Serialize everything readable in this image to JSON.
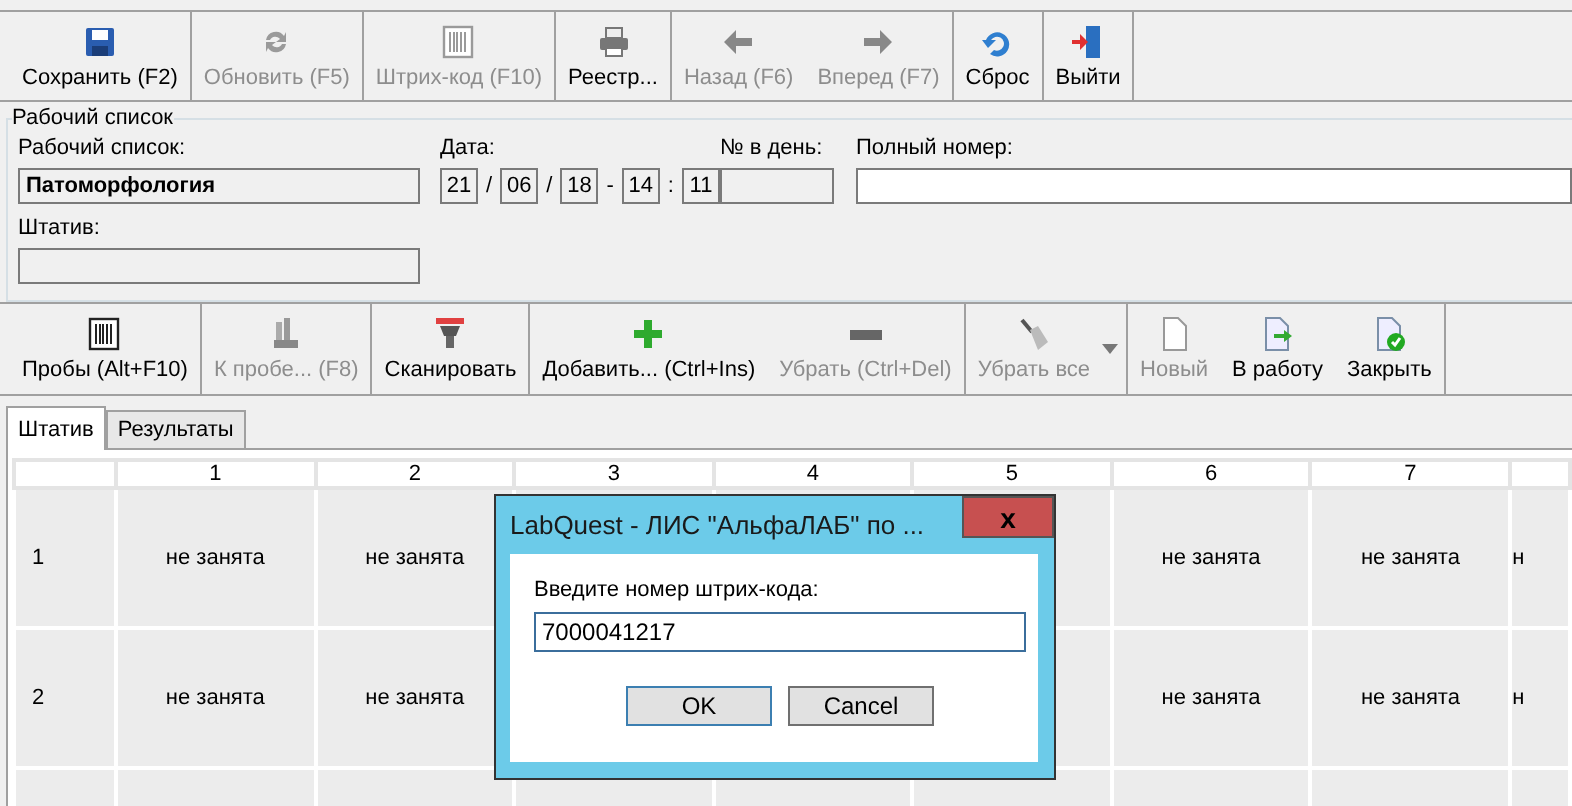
{
  "toolbar": {
    "groups": [
      [
        {
          "label": "Сохранить (F2)",
          "kind": "save",
          "disabled": false
        }
      ],
      [
        {
          "label": "Обновить (F5)",
          "kind": "refresh",
          "disabled": true
        }
      ],
      [
        {
          "label": "Штрих-код (F10)",
          "kind": "barcode",
          "disabled": true
        }
      ],
      [
        {
          "label": "Реестр...",
          "kind": "printer",
          "disabled": false
        }
      ],
      [
        {
          "label": "Назад (F6)",
          "kind": "back",
          "disabled": true
        },
        {
          "label": "Вперед (F7)",
          "kind": "forward",
          "disabled": true
        }
      ],
      [
        {
          "label": "Сброс",
          "kind": "undo",
          "disabled": false
        }
      ],
      [
        {
          "label": "Выйти",
          "kind": "exit",
          "disabled": false
        }
      ]
    ]
  },
  "worklist": {
    "title": "Рабочий список",
    "list_label": "Рабочий список:",
    "list_value": "Патоморфология",
    "date_label": "Дата:",
    "date": [
      {
        "kind": "field",
        "text": "21"
      },
      {
        "kind": "sep",
        "text": "/"
      },
      {
        "kind": "field",
        "text": "06"
      },
      {
        "kind": "sep",
        "text": "/"
      },
      {
        "kind": "field",
        "text": "18"
      },
      {
        "kind": "sep",
        "text": "-"
      },
      {
        "kind": "field",
        "text": "14"
      },
      {
        "kind": "sep",
        "text": ":"
      },
      {
        "kind": "field",
        "text": "11"
      }
    ],
    "day_number_label": "№ в день:",
    "full_number_label": "Полный номер:",
    "rack_label": "Штатив:"
  },
  "toolbar2": {
    "groups": [
      [
        {
          "label": "Пробы (Alt+F10)",
          "kind": "barcode",
          "disabled": false
        }
      ],
      [
        {
          "label": "К пробе... (F8)",
          "kind": "tubes",
          "disabled": true
        }
      ],
      [
        {
          "label": "Сканировать",
          "kind": "scanner",
          "disabled": false
        }
      ],
      [
        {
          "label": "Добавить... (Ctrl+Ins)",
          "kind": "plus",
          "disabled": false
        },
        {
          "label": "Убрать (Ctrl+Del)",
          "kind": "minus",
          "disabled": true
        }
      ],
      [
        {
          "label": "Убрать все",
          "kind": "broom",
          "disabled": true,
          "dropdown": true
        }
      ],
      [
        {
          "label": "Новый",
          "kind": "page",
          "disabled": true
        },
        {
          "label": "В работу",
          "kind": "page-arrow",
          "disabled": false
        },
        {
          "label": "Закрыть",
          "kind": "page-check",
          "disabled": false
        }
      ]
    ]
  },
  "tabs": [
    {
      "label": "Штатив",
      "selected": true
    },
    {
      "label": "Результаты",
      "selected": false
    }
  ],
  "rack": {
    "columns": [
      "1",
      "2",
      "3",
      "4",
      "5",
      "6",
      "7"
    ],
    "rows": [
      {
        "label": "1",
        "cells": [
          "не занята",
          "не занята",
          null,
          null,
          null,
          "не занята",
          "не занята",
          "н"
        ]
      },
      {
        "label": "2",
        "cells": [
          "не занята",
          "не занята",
          null,
          null,
          null,
          "не занята",
          "не занята",
          "н"
        ]
      }
    ]
  },
  "dialog": {
    "title": "LabQuest - ЛИС \"АльфаЛАБ\" по ...",
    "close": "x",
    "prompt": "Введите номер штрих-кода:",
    "value": "7000041217",
    "buttons": [
      {
        "label": "OK",
        "default": true
      },
      {
        "label": "Cancel",
        "default": false
      }
    ]
  }
}
